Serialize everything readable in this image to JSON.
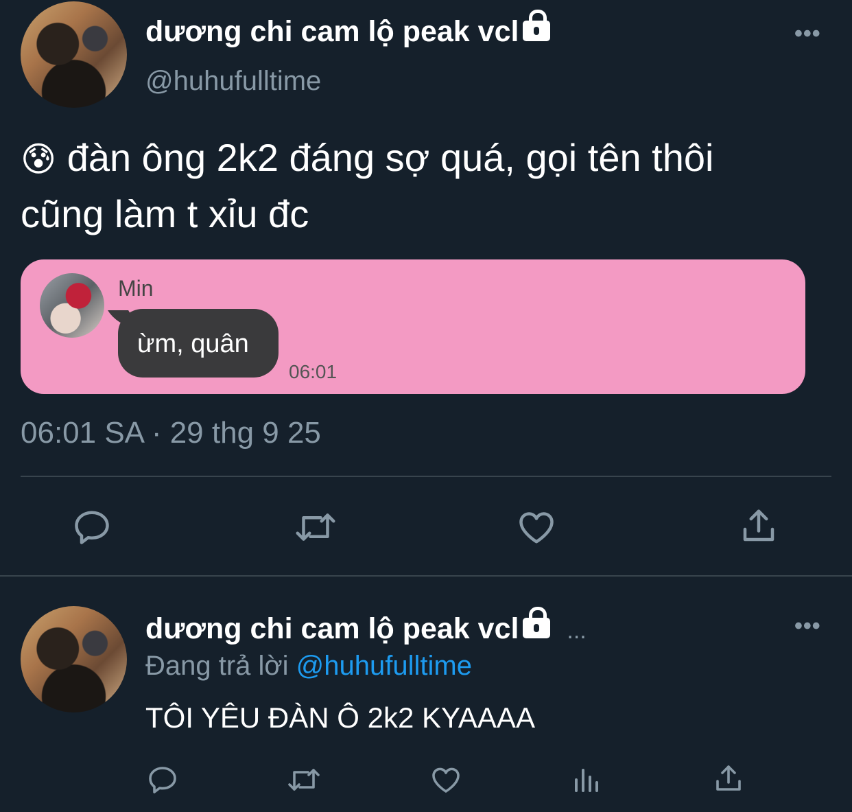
{
  "main_tweet": {
    "author_name": "dương chi cam lộ peak vcl",
    "handle": "@huhufulltime",
    "emoji": "😰",
    "text_line1": "đàn ông 2k2 đáng sợ quá, gọi tên thôi",
    "text_line2": "cũng làm t xỉu đc",
    "embedded_chat": {
      "sender": "Min",
      "message": "ừm, quân",
      "time": "06:01"
    },
    "timestamp": "06:01 SA · 29 thg 9 25"
  },
  "reply": {
    "author_name": "dương chi cam lộ peak vcl",
    "ellipsis": "...",
    "replying_prefix": "Đang trả lời",
    "replying_handle": "@huhufulltime",
    "text": "TÔI YÊU ĐÀN Ô 2k2 KYAAAA"
  },
  "more_label": "•••",
  "colors": {
    "background": "#15202b",
    "secondary_text": "#8899a6",
    "link": "#1d9bf0",
    "card": "#f39ac3",
    "bubble": "#3a3a3c",
    "divider": "#38444d"
  },
  "icons": [
    "reply-icon",
    "retweet-icon",
    "like-icon",
    "share-icon",
    "analytics-icon",
    "lock-icon",
    "more-icon"
  ]
}
